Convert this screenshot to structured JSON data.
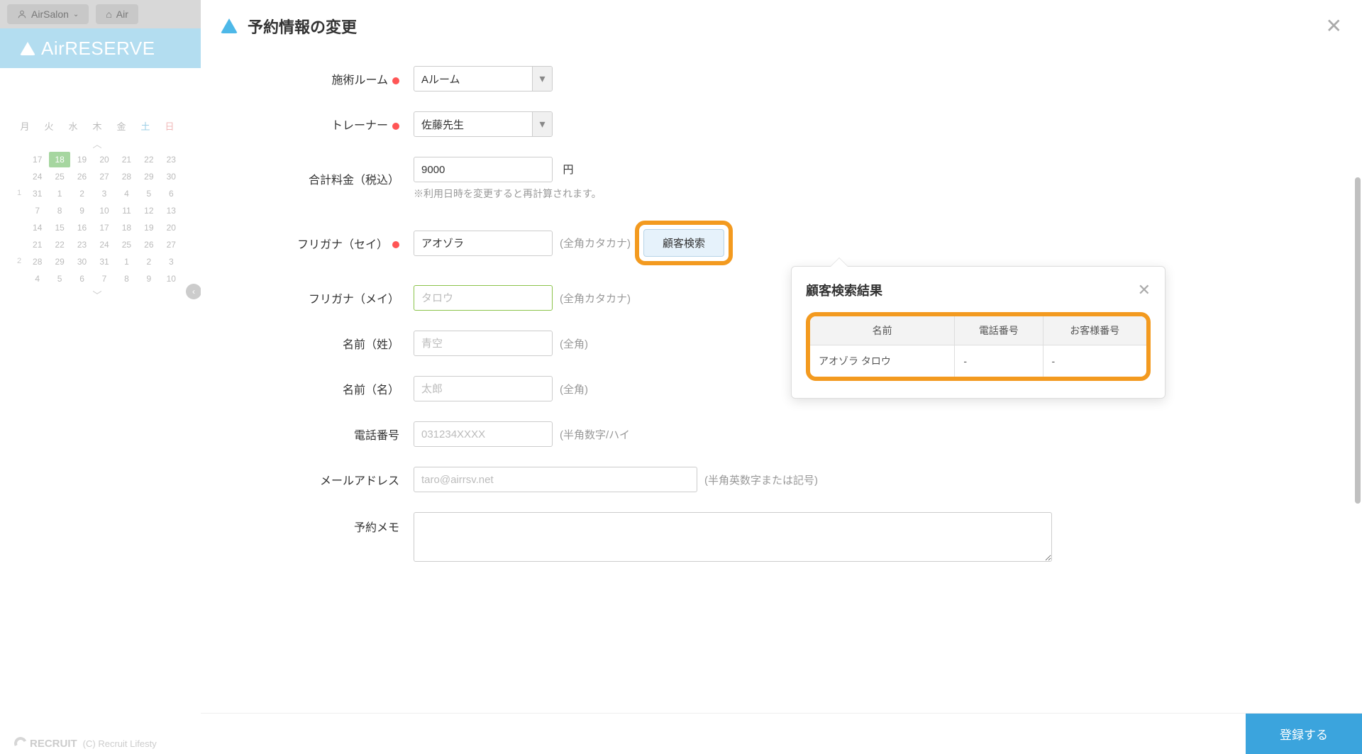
{
  "header": {
    "salon_name": "AirSalon",
    "tab2_prefix": "Air"
  },
  "logo_text": "AirRESERVE",
  "calendar": {
    "weekdays": [
      "月",
      "火",
      "水",
      "木",
      "金",
      "土",
      "日"
    ],
    "rows": [
      {
        "wk": "",
        "days": [
          "17",
          "18",
          "19",
          "20",
          "21",
          "22",
          "23"
        ]
      },
      {
        "wk": "",
        "days": [
          "24",
          "25",
          "26",
          "27",
          "28",
          "29",
          "30"
        ]
      },
      {
        "wk": "1",
        "days": [
          "31",
          "1",
          "2",
          "3",
          "4",
          "5",
          "6"
        ]
      },
      {
        "wk": "",
        "days": [
          "7",
          "8",
          "9",
          "10",
          "11",
          "12",
          "13"
        ]
      },
      {
        "wk": "",
        "days": [
          "14",
          "15",
          "16",
          "17",
          "18",
          "19",
          "20"
        ]
      },
      {
        "wk": "",
        "days": [
          "21",
          "22",
          "23",
          "24",
          "25",
          "26",
          "27"
        ]
      },
      {
        "wk": "2",
        "days": [
          "28",
          "29",
          "30",
          "31",
          "1",
          "2",
          "3"
        ]
      },
      {
        "wk": "",
        "days": [
          "4",
          "5",
          "6",
          "7",
          "8",
          "9",
          "10"
        ]
      }
    ],
    "today_row": 0,
    "today_col": 1
  },
  "modal": {
    "title": "予約情報の変更",
    "fields": {
      "room_label": "施術ルーム",
      "room_value": "Aルーム",
      "trainer_label": "トレーナー",
      "trainer_value": "佐藤先生",
      "price_label": "合計料金（税込）",
      "price_value": "9000",
      "price_unit": "円",
      "price_note": "※利用日時を変更すると再計算されます。",
      "furigana_sei_label": "フリガナ（セイ）",
      "furigana_sei_value": "アオゾラ",
      "furigana_hint": "(全角カタカナ)",
      "furigana_mei_label": "フリガナ（メイ）",
      "furigana_mei_placeholder": "タロウ",
      "name_sei_label": "名前（姓）",
      "name_sei_placeholder": "青空",
      "zenkaku_hint": "(全角)",
      "name_mei_label": "名前（名）",
      "name_mei_placeholder": "太郎",
      "phone_label": "電話番号",
      "phone_placeholder": "031234XXXX",
      "phone_hint": "(半角数字/ハイ",
      "email_label": "メールアドレス",
      "email_placeholder": "taro@airrsv.net",
      "email_hint": "(半角英数字または記号)",
      "memo_label": "予約メモ"
    },
    "search_button": "顧客検索",
    "register_button": "登録する"
  },
  "popover": {
    "title": "顧客検索結果",
    "columns": {
      "name": "名前",
      "phone": "電話番号",
      "customer_no": "お客様番号"
    },
    "rows": [
      {
        "name": "アオゾラ タロウ",
        "phone": "-",
        "customer_no": "-"
      }
    ]
  },
  "footer": {
    "recruit": "RECRUIT",
    "copyright": "(C) Recruit Lifesty"
  }
}
